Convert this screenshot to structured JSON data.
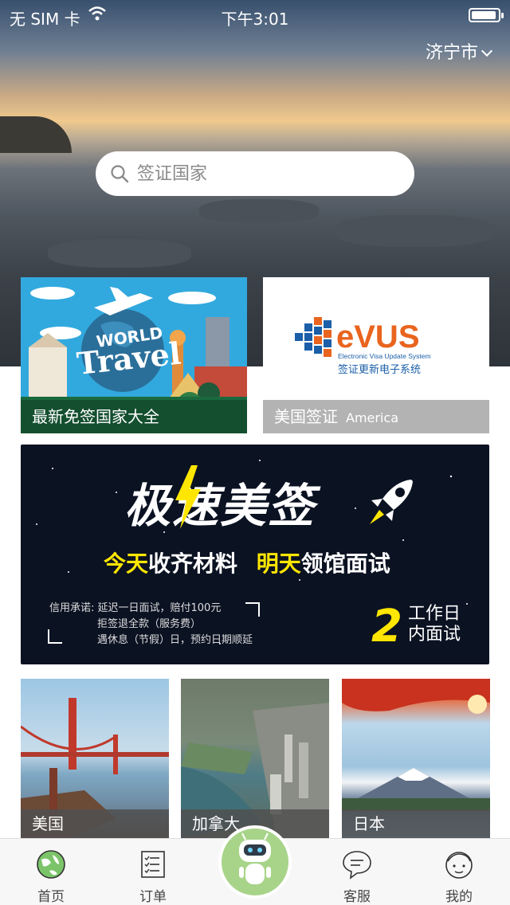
{
  "status_bar": {
    "carrier": "无 SIM 卡",
    "time": "下午3:01"
  },
  "header": {
    "city": "济宁市"
  },
  "search": {
    "placeholder": "签证国家"
  },
  "cards": [
    {
      "title": "最新免签国家大全",
      "art_text_1": "WORLD",
      "art_text_2": "Travel"
    },
    {
      "title": "美国签证",
      "subtitle": "America",
      "logo_text": "eVUS",
      "logo_sub": "Electronic Visa Update System",
      "logo_cn": "签证更新电子系统"
    }
  ],
  "banner": {
    "title": "极速美签",
    "line_a": "今天",
    "line_b": "收齐材料",
    "line_c": "明天",
    "line_d": "领馆面试",
    "promise_1": "信用承诺: 延迟一日面试，赔付100元",
    "promise_2": "拒签退全款（服务费）",
    "promise_3": "遇休息（节假）日，预约日期顺延",
    "days_num": "2",
    "days_line1": "工作日",
    "days_line2": "内面试"
  },
  "destinations": [
    {
      "label": "美国"
    },
    {
      "label": "加拿大"
    },
    {
      "label": "日本"
    }
  ],
  "tabs": [
    {
      "label": "首页"
    },
    {
      "label": "订单"
    },
    {
      "label": "客服"
    },
    {
      "label": "我的"
    }
  ],
  "colors": {
    "accent_green": "#a8d48a",
    "banner_yellow": "#ffe600",
    "evus_blue": "#1b5fa8",
    "evus_orange": "#e9641e"
  }
}
